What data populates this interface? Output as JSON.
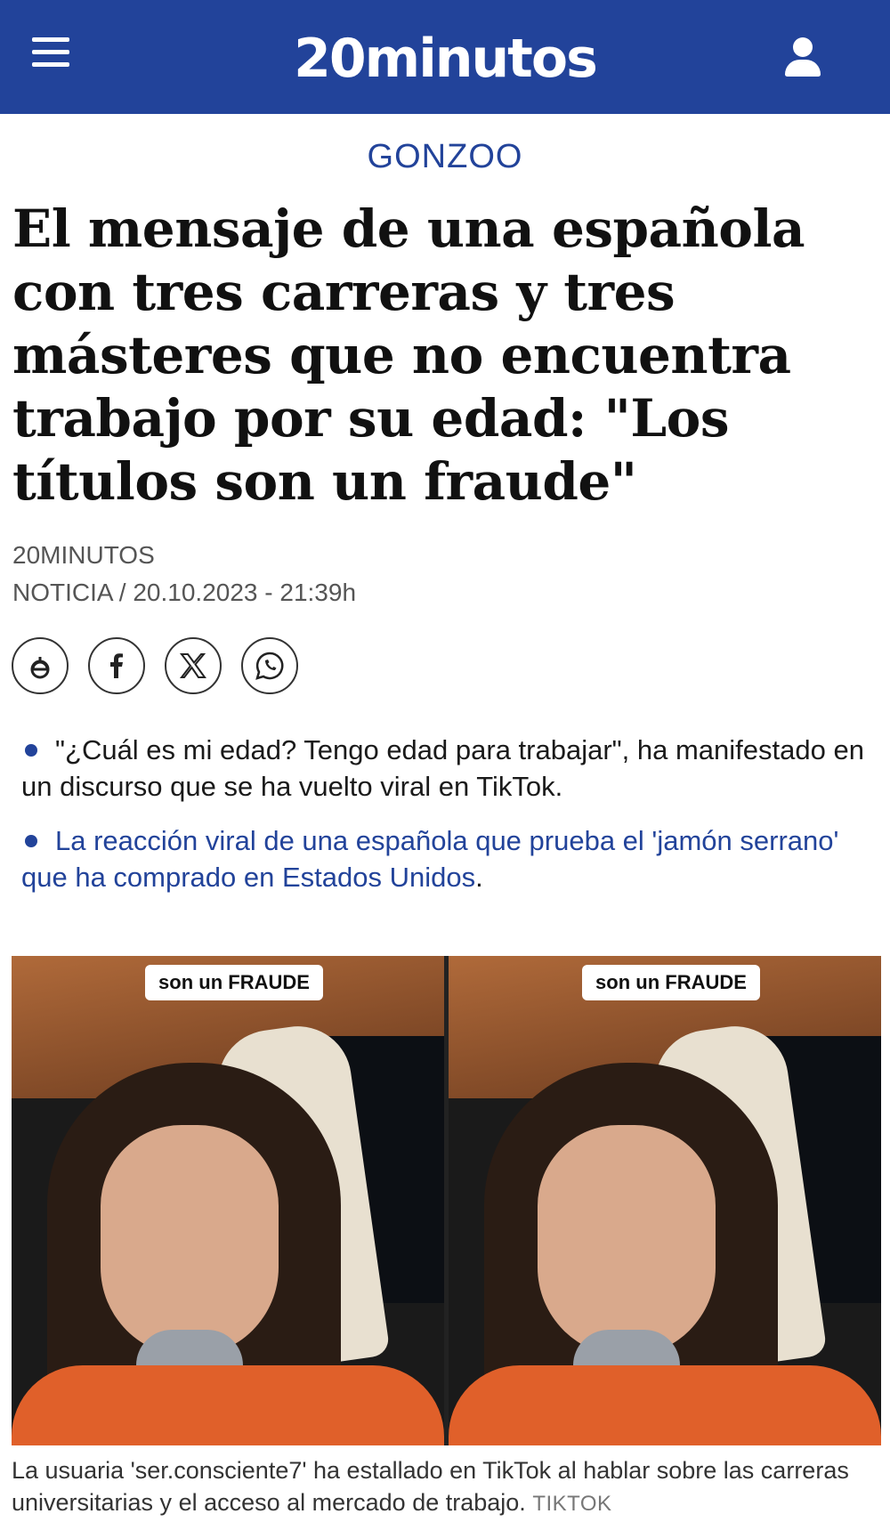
{
  "header": {
    "logo": "20minutos",
    "menu_icon": "hamburger-menu-icon",
    "user_icon": "user-icon",
    "bg_color": "#22439a"
  },
  "article": {
    "section": "GONZOO",
    "headline": "El mensaje de una española con tres carreras y tres másteres que no encuentra trabajo por su edad: \"Los títulos son un fraude\"",
    "author": "20MINUTOS",
    "meta": "NOTICIA  / 20.10.2023 - 21:39h",
    "share": [
      {
        "icon": "share-e-icon"
      },
      {
        "icon": "facebook-icon"
      },
      {
        "icon": "x-twitter-icon"
      },
      {
        "icon": "whatsapp-icon"
      }
    ],
    "bullets": [
      {
        "text": "\"¿Cuál es mi edad? Tengo edad para trabajar\", ha manifestado en un discurso que se ha vuelto viral en TikTok."
      },
      {
        "link_text": "La reacción viral de una española que prueba el 'jamón serrano' que ha comprado en Estados Unidos",
        "tail": "."
      }
    ],
    "image": {
      "overlay_text": "son un FRAUDE",
      "caption": "La usuaria 'ser.consciente7' ha estallado en TikTok al hablar sobre las carreras universitarias y el acceso al mercado de trabajo.",
      "credit": "TIKTOK"
    }
  }
}
